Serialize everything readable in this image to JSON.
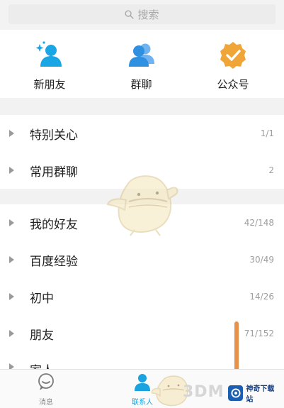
{
  "search": {
    "placeholder": "搜索"
  },
  "shortcuts": [
    {
      "label": "新朋友",
      "icon": "add-friend-icon",
      "color": "#1aa6e5"
    },
    {
      "label": "群聊",
      "icon": "group-chat-icon",
      "color": "#2f8fe0"
    },
    {
      "label": "公众号",
      "icon": "official-account-icon",
      "color": "#f0a538"
    }
  ],
  "groups": [
    {
      "name": "特别关心",
      "count": "1/1"
    },
    {
      "name": "常用群聊",
      "count": "2"
    },
    {
      "name": "我的好友",
      "count": "42/148"
    },
    {
      "name": "百度经验",
      "count": "30/49"
    },
    {
      "name": "初中",
      "count": "14/26"
    },
    {
      "name": "朋友",
      "count": "71/152"
    },
    {
      "name": "家人",
      "count": ""
    }
  ],
  "bottom_nav": {
    "messages_label": "消息",
    "contacts_label": "联系人"
  },
  "watermarks": {
    "brand_text": "3DM",
    "site_name": "神奇下载站"
  },
  "colors": {
    "accent": "#19a3e0",
    "scrollbar": "#e8914a"
  }
}
